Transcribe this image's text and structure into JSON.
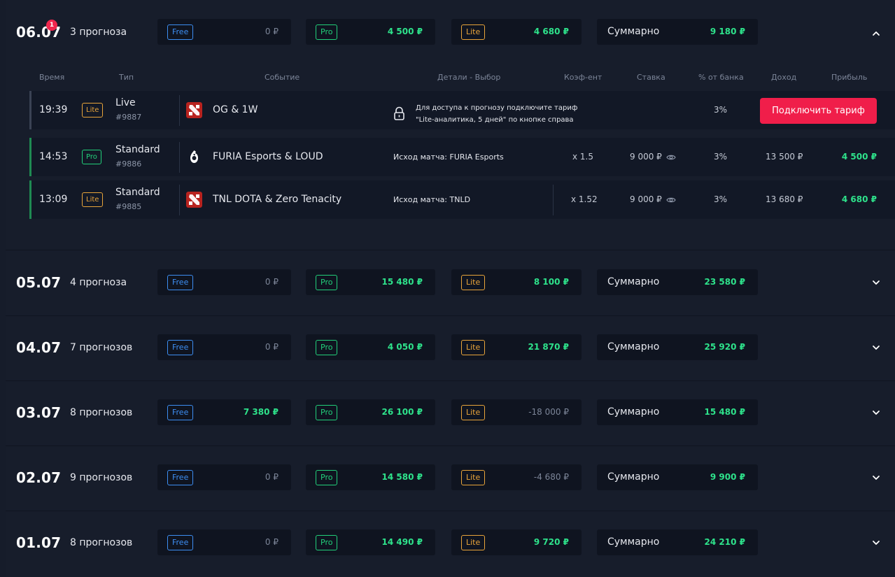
{
  "days": [
    {
      "date": "06.07",
      "count": "3 прогноза",
      "badge": "1",
      "free_label": "Free",
      "free_value": "0 ₽",
      "pro_label": "Pro",
      "pro_value": "4 500 ₽",
      "lite_label": "Lite",
      "lite_value": "4 680 ₽",
      "sum_label": "Суммарно",
      "sum_value": "9 180 ₽",
      "expanded": true
    },
    {
      "date": "05.07",
      "count": "4 прогноза",
      "free_label": "Free",
      "free_value": "0 ₽",
      "pro_label": "Pro",
      "pro_value": "15 480 ₽",
      "lite_label": "Lite",
      "lite_value": "8 100 ₽",
      "sum_label": "Суммарно",
      "sum_value": "23 580 ₽"
    },
    {
      "date": "04.07",
      "count": "7 прогнозов",
      "free_label": "Free",
      "free_value": "0 ₽",
      "pro_label": "Pro",
      "pro_value": "4 050 ₽",
      "lite_label": "Lite",
      "lite_value": "21 870 ₽",
      "sum_label": "Суммарно",
      "sum_value": "25 920 ₽"
    },
    {
      "date": "03.07",
      "count": "8 прогнозов",
      "free_label": "Free",
      "free_value": "7 380 ₽",
      "pro_label": "Pro",
      "pro_value": "26 100 ₽",
      "lite_label": "Lite",
      "lite_value": "-18 000 ₽",
      "sum_label": "Суммарно",
      "sum_value": "15 480 ₽"
    },
    {
      "date": "02.07",
      "count": "9 прогнозов",
      "free_label": "Free",
      "free_value": "0 ₽",
      "pro_label": "Pro",
      "pro_value": "14 580 ₽",
      "lite_label": "Lite",
      "lite_value": "-4 680 ₽",
      "sum_label": "Суммарно",
      "sum_value": "9 900 ₽"
    },
    {
      "date": "01.07",
      "count": "8 прогнозов",
      "free_label": "Free",
      "free_value": "0 ₽",
      "pro_label": "Pro",
      "pro_value": "14 490 ₽",
      "lite_label": "Lite",
      "lite_value": "9 720 ₽",
      "sum_label": "Суммарно",
      "sum_value": "24 210 ₽"
    }
  ],
  "columns": {
    "time": "Время",
    "type": "Тип",
    "event": "Событие",
    "details": "Детали - Выбор",
    "odds": "Коэф-ент",
    "stake": "Ставка",
    "bank_pct": "% от банка",
    "income": "Доход",
    "profit": "Прибыль"
  },
  "predictions": [
    {
      "time": "19:39",
      "tier": "Lite",
      "type": "Live",
      "id": "#9887",
      "game_icon": "dota2-icon",
      "event": "OG & 1W",
      "locked": true,
      "lock_text_1": "Для доступа к прогнозу подключите тариф",
      "lock_text_2": "\"Lite-аналитика, 5 дней\" по кнопке справа",
      "bank_pct": "3%",
      "cta": "Подключить тариф"
    },
    {
      "time": "14:53",
      "tier": "Pro",
      "type": "Standard",
      "id": "#9886",
      "game_icon": "rainbow-six-icon",
      "event": "FURIA Esports & LOUD",
      "details": "Исход матча: FURIA Esports",
      "odds": "x 1.5",
      "stake": "9 000 ₽",
      "bank_pct": "3%",
      "income": "13 500 ₽",
      "profit": "4 500 ₽"
    },
    {
      "time": "13:09",
      "tier": "Lite",
      "type": "Standard",
      "id": "#9885",
      "game_icon": "dota2-icon",
      "event": "TNL DOTA & Zero Tenacity",
      "details": "Исход матча: TNLD",
      "odds": "x 1.52",
      "stake": "9 000 ₽",
      "bank_pct": "3%",
      "income": "13 680 ₽",
      "profit": "4 680 ₽"
    }
  ],
  "colors": {
    "free": "#3d8ef2",
    "pro": "#22d07a",
    "lite": "#e8a43a",
    "positive": "#2ee28b",
    "cta": "#f01e4a",
    "badge": "#f0264d"
  }
}
